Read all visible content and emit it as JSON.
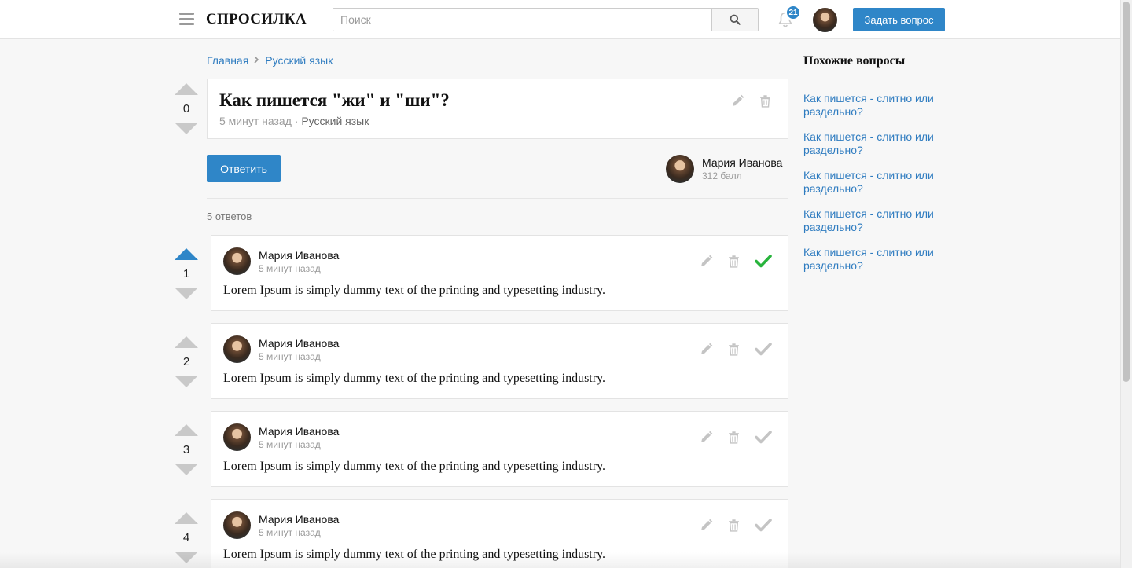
{
  "header": {
    "logo": "СПРОСИЛКА",
    "search_placeholder": "Поиск",
    "notifications_count": "21",
    "ask_button": "Задать вопрос"
  },
  "breadcrumb": {
    "home": "Главная",
    "category": "Русский язык"
  },
  "question": {
    "votes": "0",
    "title": "Как пишется \"жи\" и \"ши\"?",
    "time": "5 минут назад",
    "separator": "·",
    "category": "Русский язык",
    "answer_button": "Ответить",
    "author": {
      "name": "Мария Иванова",
      "score": "312 балл"
    }
  },
  "answers_count": "5 ответов",
  "answers": [
    {
      "votes": "1",
      "upvoted": true,
      "accepted": true,
      "author": "Мария Иванова",
      "time": "5 минут назад",
      "text": "Lorem Ipsum is simply dummy text of the printing and typesetting industry."
    },
    {
      "votes": "2",
      "upvoted": false,
      "accepted": false,
      "author": "Мария Иванова",
      "time": "5 минут назад",
      "text": "Lorem Ipsum is simply dummy text of the printing and typesetting industry."
    },
    {
      "votes": "3",
      "upvoted": false,
      "accepted": false,
      "author": "Мария Иванова",
      "time": "5 минут назад",
      "text": "Lorem Ipsum is simply dummy text of the printing and typesetting industry."
    },
    {
      "votes": "4",
      "upvoted": false,
      "accepted": false,
      "author": "Мария Иванова",
      "time": "5 минут назад",
      "text": "Lorem Ipsum is simply dummy text of the printing and typesetting industry."
    }
  ],
  "sidebar": {
    "title": "Похожие вопросы",
    "links": [
      "Как пишется - слитно или раздельно?",
      "Как пишется - слитно или раздельно?",
      "Как пишется - слитно или раздельно?",
      "Как пишется - слитно или раздельно?",
      "Как пишется - слитно или раздельно?"
    ]
  },
  "colors": {
    "accent": "#2f86c8",
    "link": "#2f7cc0",
    "accepted": "#28b43c",
    "icon_gray": "#c4c4c4"
  }
}
